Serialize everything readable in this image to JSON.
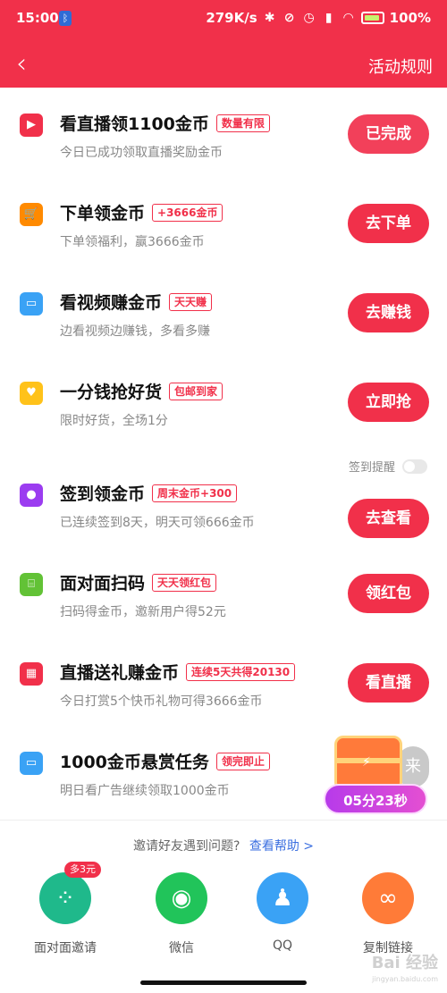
{
  "status_bar": {
    "time": "15:00",
    "speed": "279K/s",
    "battery_pct": "100"
  },
  "nav": {
    "back_glyph": "‹",
    "rules_label": "活动规则"
  },
  "tasks": [
    {
      "icon": "live-tv-icon",
      "color": "#f1304a",
      "title": "看直播领1100金币",
      "tag": "数量有限",
      "desc": "今日已成功领取直播奖励金币",
      "button": "已完成"
    },
    {
      "icon": "cart-icon",
      "color": "#ff8a00",
      "title": "下单领金币",
      "tag": "+3666金币",
      "desc": "下单领福利，赢3666金币",
      "button": "去下单"
    },
    {
      "icon": "tv-icon",
      "color": "#3aa2f5",
      "title": "看视频赚金币",
      "tag": "天天赚",
      "desc": "边看视频边赚钱，多看多赚",
      "button": "去赚钱"
    },
    {
      "icon": "shopping-bag-icon",
      "color": "#ffc21a",
      "title": "一分钱抢好货",
      "tag": "包邮到家",
      "desc": "限时好货，全场1分",
      "button": "立即抢"
    },
    {
      "icon": "location-pin-icon",
      "color": "#9b3cf0",
      "title": "签到领金币",
      "tag": "周末金币+300",
      "desc": "已连续签到8天，明天可领666金币",
      "button": "去查看"
    },
    {
      "icon": "scan-icon",
      "color": "#62c236",
      "title": "面对面扫码",
      "tag": "天天领红包",
      "desc": "扫码得金币，邀新用户得52元",
      "button": "领红包"
    },
    {
      "icon": "live-gift-icon",
      "color": "#f1304a",
      "title": "直播送礼赚金币",
      "tag": "连续5天共得20130",
      "desc": "今日打赏5个快币礼物可得3666金币",
      "button": "看直播"
    },
    {
      "icon": "tv-icon",
      "color": "#3aa2f5",
      "title": "1000金币悬赏任务",
      "tag": "领完即止",
      "desc": "明日看广告继续领取1000金币",
      "button": ""
    }
  ],
  "checkin_reminder": {
    "label": "签到提醒"
  },
  "chest": {
    "side_text": "来",
    "timer": "05分23秒"
  },
  "share_sheet": {
    "help_text": "邀请好友遇到问题?",
    "help_link": "查看帮助 >",
    "items": [
      {
        "label": "面对面邀请",
        "icon": "grid-icon",
        "color": "#1fb98b",
        "badge": "多3元"
      },
      {
        "label": "微信",
        "icon": "wechat-icon",
        "color": "#21c45a",
        "badge": ""
      },
      {
        "label": "QQ",
        "icon": "qq-icon",
        "color": "#3aa2f5",
        "badge": ""
      },
      {
        "label": "复制链接",
        "icon": "link-icon",
        "color": "#ff7b38",
        "badge": ""
      }
    ]
  },
  "watermark": {
    "text": "Bai 经验",
    "sub": "jingyan.baidu.com"
  }
}
